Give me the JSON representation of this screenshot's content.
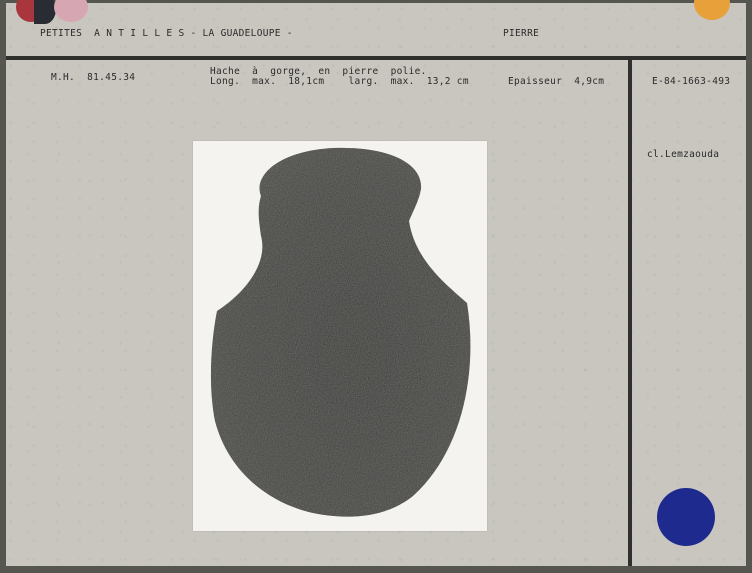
{
  "header": {
    "region": "PETITES  A N T I L L E S - LA GUADELOUPE -",
    "material": "PIERRE"
  },
  "record": {
    "inventory": "M.H.  81.45.34",
    "description_line1": "Hache  à  gorge,  en  pierre  polie.",
    "description_line2": "Long.  max.  18,1cm    larg.  max.  13,2 cm",
    "thickness": "Epaisseur  4,9cm"
  },
  "side": {
    "negative_number": "E-84-1663-493",
    "photo_credit": "cl.Lemzaouda"
  },
  "colors": {
    "card": "#c8c6bf",
    "ink": "#2b2b2b",
    "dot_red": "#a8363c",
    "dot_dark": "#2a2c33",
    "dot_pink": "#d6a7b2",
    "dot_orange": "#e8a13a",
    "dot_blue": "#1e2a8e",
    "stone": "#3a3a37"
  },
  "image": {
    "subject_icon": "stone-axe-photo"
  }
}
